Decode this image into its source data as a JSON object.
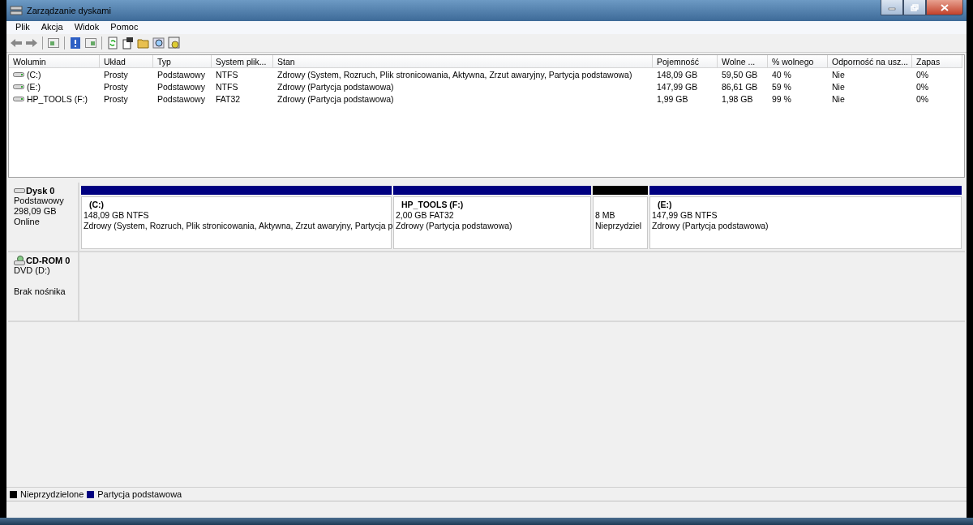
{
  "window": {
    "title": "Zarządzanie dyskami"
  },
  "menu": [
    "Plik",
    "Akcja",
    "Widok",
    "Pomoc"
  ],
  "table": {
    "columns": [
      "Wolumin",
      "Układ",
      "Typ",
      "System plik...",
      "Stan",
      "Pojemność",
      "Wolne ...",
      "% wolnego",
      "Odporność na usz...",
      "Zapas"
    ],
    "rows": [
      {
        "kind": "disk",
        "cells": [
          "(C:)",
          "Prosty",
          "Podstawowy",
          "NTFS",
          "Zdrowy (System, Rozruch, Plik stronicowania, Aktywna, Zrzut awaryjny, Partycja podstawowa)",
          "148,09 GB",
          "59,50 GB",
          "40 %",
          "Nie",
          "0%"
        ]
      },
      {
        "kind": "disk",
        "cells": [
          "(E:)",
          "Prosty",
          "Podstawowy",
          "NTFS",
          "Zdrowy (Partycja podstawowa)",
          "147,99 GB",
          "86,61 GB",
          "59 %",
          "Nie",
          "0%"
        ]
      },
      {
        "kind": "disk",
        "cells": [
          "HP_TOOLS (F:)",
          "Prosty",
          "Podstawowy",
          "FAT32",
          "Zdrowy (Partycja podstawowa)",
          "1,99 GB",
          "1,98 GB",
          "99 %",
          "Nie",
          "0%"
        ]
      }
    ]
  },
  "disks": [
    {
      "kind": "hdd",
      "name": "Dysk 0",
      "lines": [
        "Podstawowy",
        "298,09 GB",
        "Online"
      ],
      "partitions": [
        {
          "kind": "primary",
          "label": "(C:)",
          "size": "148,09 GB NTFS",
          "status": "Zdrowy (System, Rozruch, Plik stronicowania, Aktywna, Zrzut awaryjny, Partycja p"
        },
        {
          "kind": "primary",
          "label": "HP_TOOLS  (F:)",
          "size": "2,00 GB FAT32",
          "status": "Zdrowy (Partycja podstawowa)"
        },
        {
          "kind": "unallocated",
          "size": "8 MB",
          "status": "Nieprzydziel"
        },
        {
          "kind": "primary",
          "label": "(E:)",
          "size": "147,99 GB NTFS",
          "status": "Zdrowy (Partycja podstawowa)"
        }
      ]
    },
    {
      "kind": "cdrom",
      "name": "CD-ROM 0",
      "lines": [
        "DVD (D:)"
      ],
      "note": "Brak nośnika"
    }
  ],
  "legend": [
    {
      "label": "Nieprzydzielone",
      "color": "#000000"
    },
    {
      "label": "Partycja podstawowa",
      "color": "#000080"
    }
  ]
}
